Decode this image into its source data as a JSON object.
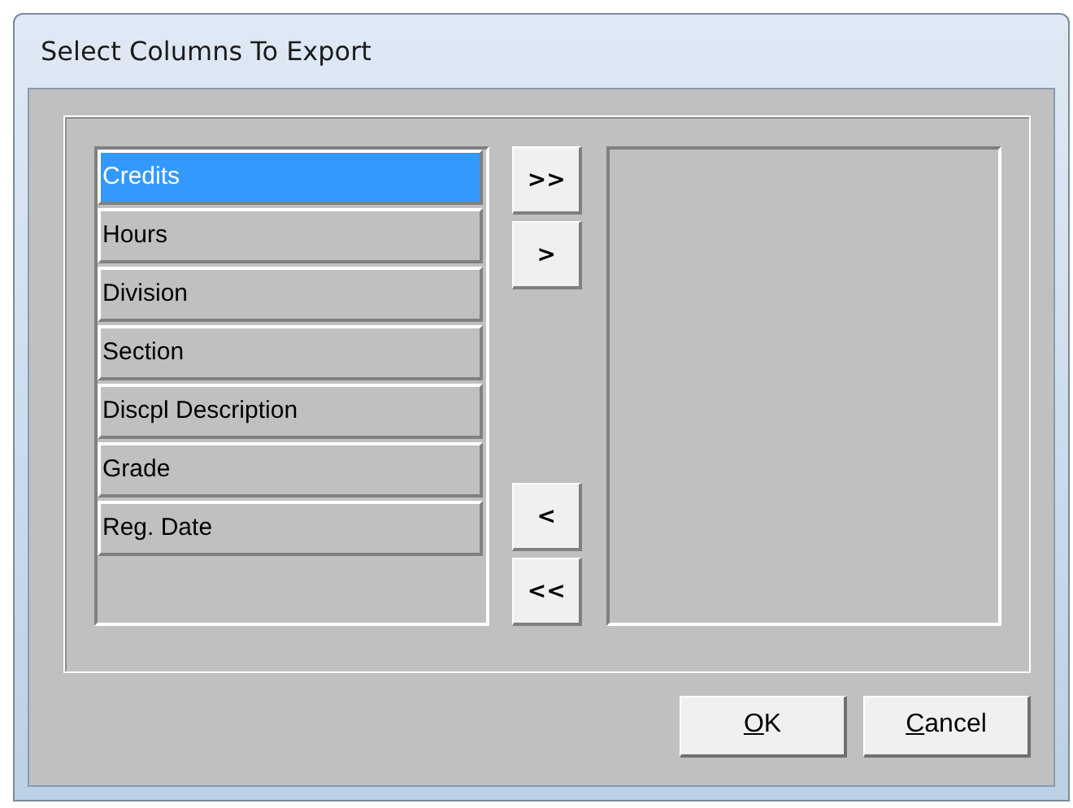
{
  "window": {
    "title": "Select Columns To Export"
  },
  "available_columns": [
    {
      "label": "Credits",
      "selected": true
    },
    {
      "label": "Hours",
      "selected": false
    },
    {
      "label": "Division",
      "selected": false
    },
    {
      "label": "Section",
      "selected": false
    },
    {
      "label": "Discpl Description",
      "selected": false
    },
    {
      "label": "Grade",
      "selected": false
    },
    {
      "label": "Reg. Date",
      "selected": false
    }
  ],
  "move_buttons": [
    {
      "label": ">>",
      "kind": "top"
    },
    {
      "label": ">",
      "kind": "top"
    },
    {
      "label": "<",
      "kind": "bottom"
    },
    {
      "label": "<<",
      "kind": "bottom"
    }
  ],
  "buttons": [
    {
      "label": "OK",
      "underline_first": true
    },
    {
      "label": "Cancel",
      "underline_first": true
    }
  ]
}
